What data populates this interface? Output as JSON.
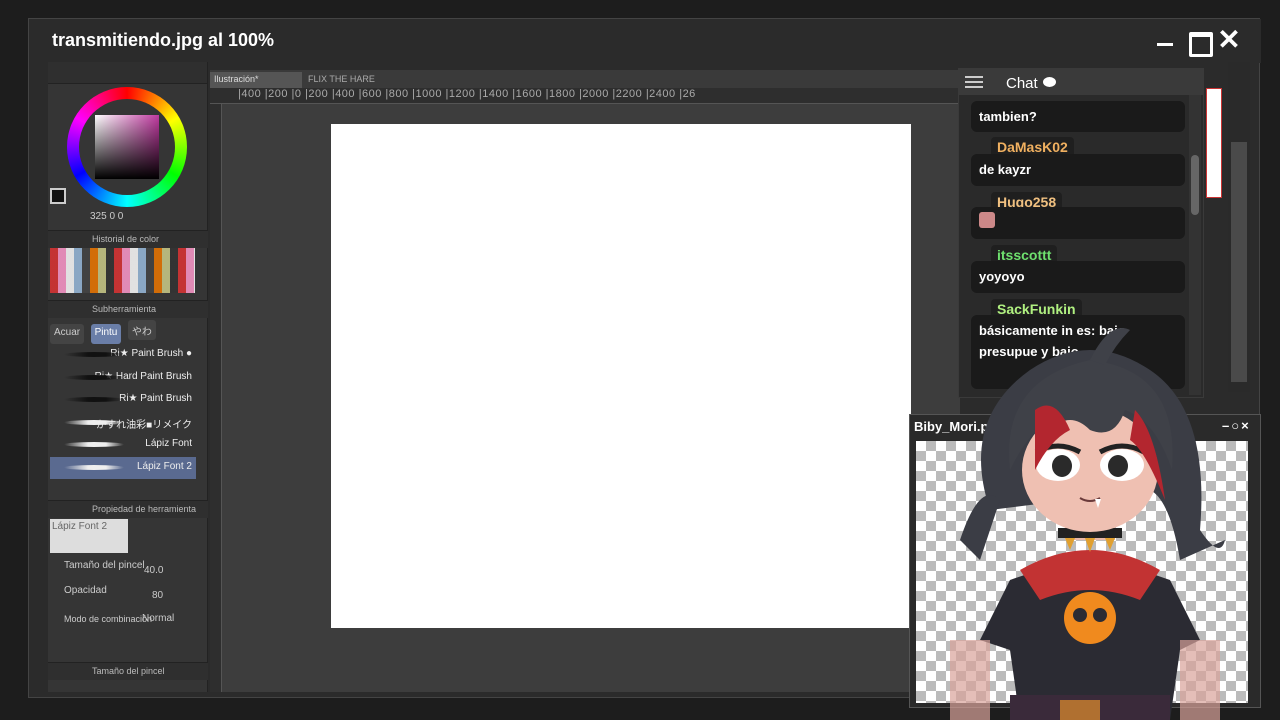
{
  "window": {
    "title": "transmitiendo.jpg al 100%"
  },
  "left_panel": {
    "hsv": "325   0   0",
    "color_history_label": "Historial de color",
    "subtool_label": "Subherramienta",
    "tabs": [
      "Acuar",
      "Pintu",
      "やわ"
    ],
    "brushes": [
      "Ri★ Paint Brush ●",
      "Ri★ Hard Paint Brush",
      "Ri★ Paint Brush",
      "かすれ油彩■リメイク",
      "Lápiz Font",
      "Lápiz Font 2"
    ],
    "tool_property_label": "Propiedad de herramienta",
    "preview_label": "Lápiz Font 2",
    "brush_size_label": "Tamaño del pincel",
    "brush_size_value": "40.0",
    "opacity_label": "Opacidad",
    "opacity_value": "80",
    "blend_label": "Modo de combinación",
    "blend_value": "Normal",
    "brush_size_section": "Tamaño del pincel"
  },
  "doc_tabs": [
    "Ilustración*",
    "FLIX THE HARE"
  ],
  "ruler_text": "|400  |200  |0  |200  |400  |600  |800  |1000  |1200  |1400  |1600  |1800  |2000  |2200  |2400  |26",
  "chat": {
    "title": "Chat",
    "messages": [
      {
        "user": "",
        "text": "tambien?"
      },
      {
        "user": "DaMasK02",
        "user_color": "#f0b060",
        "text": "de kayzr"
      },
      {
        "user": "Hugo258",
        "user_color": "#f0c080",
        "text": ""
      },
      {
        "user": "itsscottt",
        "user_color": "#6ee06e",
        "text": "yoyoyo"
      },
      {
        "user": "SackFunkin",
        "user_color": "#b0f080",
        "text": "básicamente in    es: bajo presupue        y bajo "
      }
    ]
  },
  "preview_window": {
    "title": "Biby_Mori.pr",
    "controls": "–○×"
  }
}
